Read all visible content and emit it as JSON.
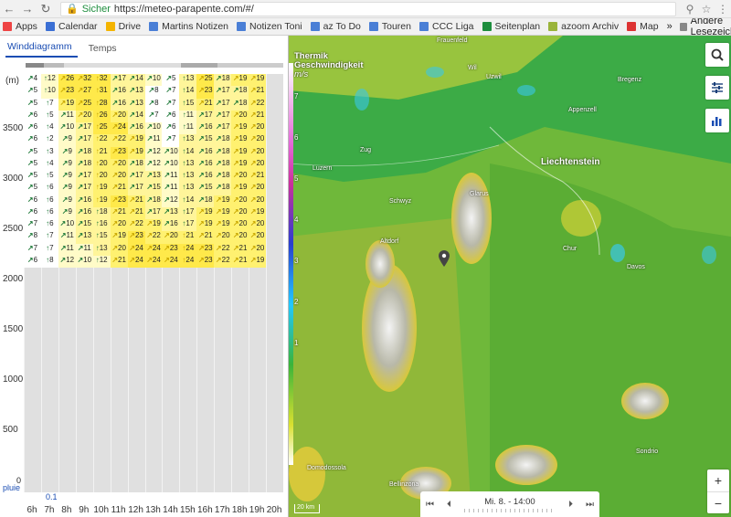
{
  "browser": {
    "secure_label": "Sicher",
    "url": "https://meteo-parapente.com/#/"
  },
  "bookmarks": [
    {
      "label": "Apps",
      "color": "#e44"
    },
    {
      "label": "Calendar",
      "color": "#3b6fd4"
    },
    {
      "label": "Drive",
      "color": "#f4b400"
    },
    {
      "label": "Martins Notizen",
      "color": "#4a7fd6"
    },
    {
      "label": "Notizen Toni",
      "color": "#4a7fd6"
    },
    {
      "label": "az To Do",
      "color": "#4a7fd6"
    },
    {
      "label": "Touren",
      "color": "#4a7fd6"
    },
    {
      "label": "CCC Liga",
      "color": "#4a7fd6"
    },
    {
      "label": "Seitenplan",
      "color": "#1e8e3e"
    },
    {
      "label": "azoom Archiv",
      "color": "#9ab43a"
    },
    {
      "label": "Map",
      "color": "#d33"
    }
  ],
  "bookmarks_other": "Andere Lesezeichen",
  "tabs": {
    "wind": "Winddiagramm",
    "temps": "Temps"
  },
  "yaxis": {
    "unit": "(m)",
    "labels": [
      "3500",
      "3000",
      "2500",
      "2000",
      "1500",
      "1000",
      "500",
      "0"
    ]
  },
  "xaxis": {
    "hours": [
      "6h",
      "7h",
      "8h",
      "9h",
      "10h",
      "11h",
      "12h",
      "13h",
      "14h",
      "15h",
      "16h",
      "17h",
      "18h",
      "19h",
      "20h"
    ],
    "precip_label": "pluie",
    "precip_value": "0.1"
  },
  "wind_rows": [
    [
      "4",
      "12",
      "26",
      "32",
      "32",
      "17",
      "14",
      "10",
      "5",
      "13",
      "25",
      "18",
      "19",
      "19"
    ],
    [
      "5",
      "10",
      "23",
      "27",
      "31",
      "16",
      "13",
      "8",
      "7",
      "14",
      "23",
      "17",
      "18",
      "21"
    ],
    [
      "5",
      "7",
      "19",
      "25",
      "28",
      "16",
      "13",
      "8",
      "7",
      "15",
      "21",
      "17",
      "18",
      "22"
    ],
    [
      "6",
      "5",
      "11",
      "20",
      "26",
      "20",
      "14",
      "7",
      "6",
      "11",
      "17",
      "17",
      "20",
      "21"
    ],
    [
      "6",
      "4",
      "10",
      "17",
      "25",
      "24",
      "16",
      "10",
      "6",
      "11",
      "16",
      "17",
      "19",
      "20"
    ],
    [
      "6",
      "2",
      "9",
      "17",
      "22",
      "22",
      "19",
      "11",
      "7",
      "13",
      "15",
      "18",
      "19",
      "20"
    ],
    [
      "5",
      "3",
      "9",
      "18",
      "21",
      "23",
      "19",
      "12",
      "10",
      "14",
      "16",
      "18",
      "19",
      "20"
    ],
    [
      "5",
      "4",
      "9",
      "18",
      "20",
      "20",
      "18",
      "12",
      "10",
      "13",
      "16",
      "18",
      "19",
      "20"
    ],
    [
      "5",
      "5",
      "9",
      "17",
      "20",
      "20",
      "17",
      "13",
      "11",
      "13",
      "16",
      "18",
      "20",
      "21"
    ],
    [
      "5",
      "6",
      "9",
      "17",
      "19",
      "21",
      "17",
      "15",
      "11",
      "13",
      "15",
      "18",
      "19",
      "20"
    ],
    [
      "6",
      "6",
      "9",
      "16",
      "19",
      "23",
      "21",
      "18",
      "12",
      "14",
      "18",
      "19",
      "20",
      "20"
    ],
    [
      "6",
      "6",
      "9",
      "16",
      "18",
      "21",
      "21",
      "17",
      "13",
      "17",
      "19",
      "19",
      "20",
      "19"
    ],
    [
      "7",
      "6",
      "10",
      "15",
      "16",
      "20",
      "22",
      "19",
      "16",
      "17",
      "19",
      "19",
      "20",
      "20"
    ],
    [
      "8",
      "7",
      "11",
      "13",
      "15",
      "19",
      "23",
      "22",
      "20",
      "21",
      "21",
      "20",
      "20",
      "20"
    ],
    [
      "7",
      "7",
      "11",
      "11",
      "13",
      "20",
      "24",
      "24",
      "23",
      "24",
      "23",
      "22",
      "21",
      "20"
    ],
    [
      "6",
      "8",
      "12",
      "10",
      "12",
      "21",
      "24",
      "24",
      "24",
      "24",
      "23",
      "22",
      "21",
      "19"
    ]
  ],
  "map": {
    "title_line1": "Thermik",
    "title_line2": "Geschwindigkeit",
    "unit": "m/s",
    "scale_labels": [
      "7",
      "6",
      "5",
      "4",
      "3",
      "2",
      "1"
    ],
    "places": [
      {
        "name": "Liechtenstein",
        "big": true
      },
      {
        "name": "Frauenfeld"
      },
      {
        "name": "Wil"
      },
      {
        "name": "Uzwil"
      },
      {
        "name": "Appenzell"
      },
      {
        "name": "Bregenz"
      },
      {
        "name": "Glarus"
      },
      {
        "name": "Schwyz"
      },
      {
        "name": "Altdorf"
      },
      {
        "name": "Luzern"
      },
      {
        "name": "Zug"
      },
      {
        "name": "Chur"
      },
      {
        "name": "Davos"
      },
      {
        "name": "Sondrio"
      },
      {
        "name": "Bellinzona"
      },
      {
        "name": "Domodossola"
      }
    ],
    "scale_label": "20 km",
    "time": "Mi. 8. - 14:00"
  }
}
